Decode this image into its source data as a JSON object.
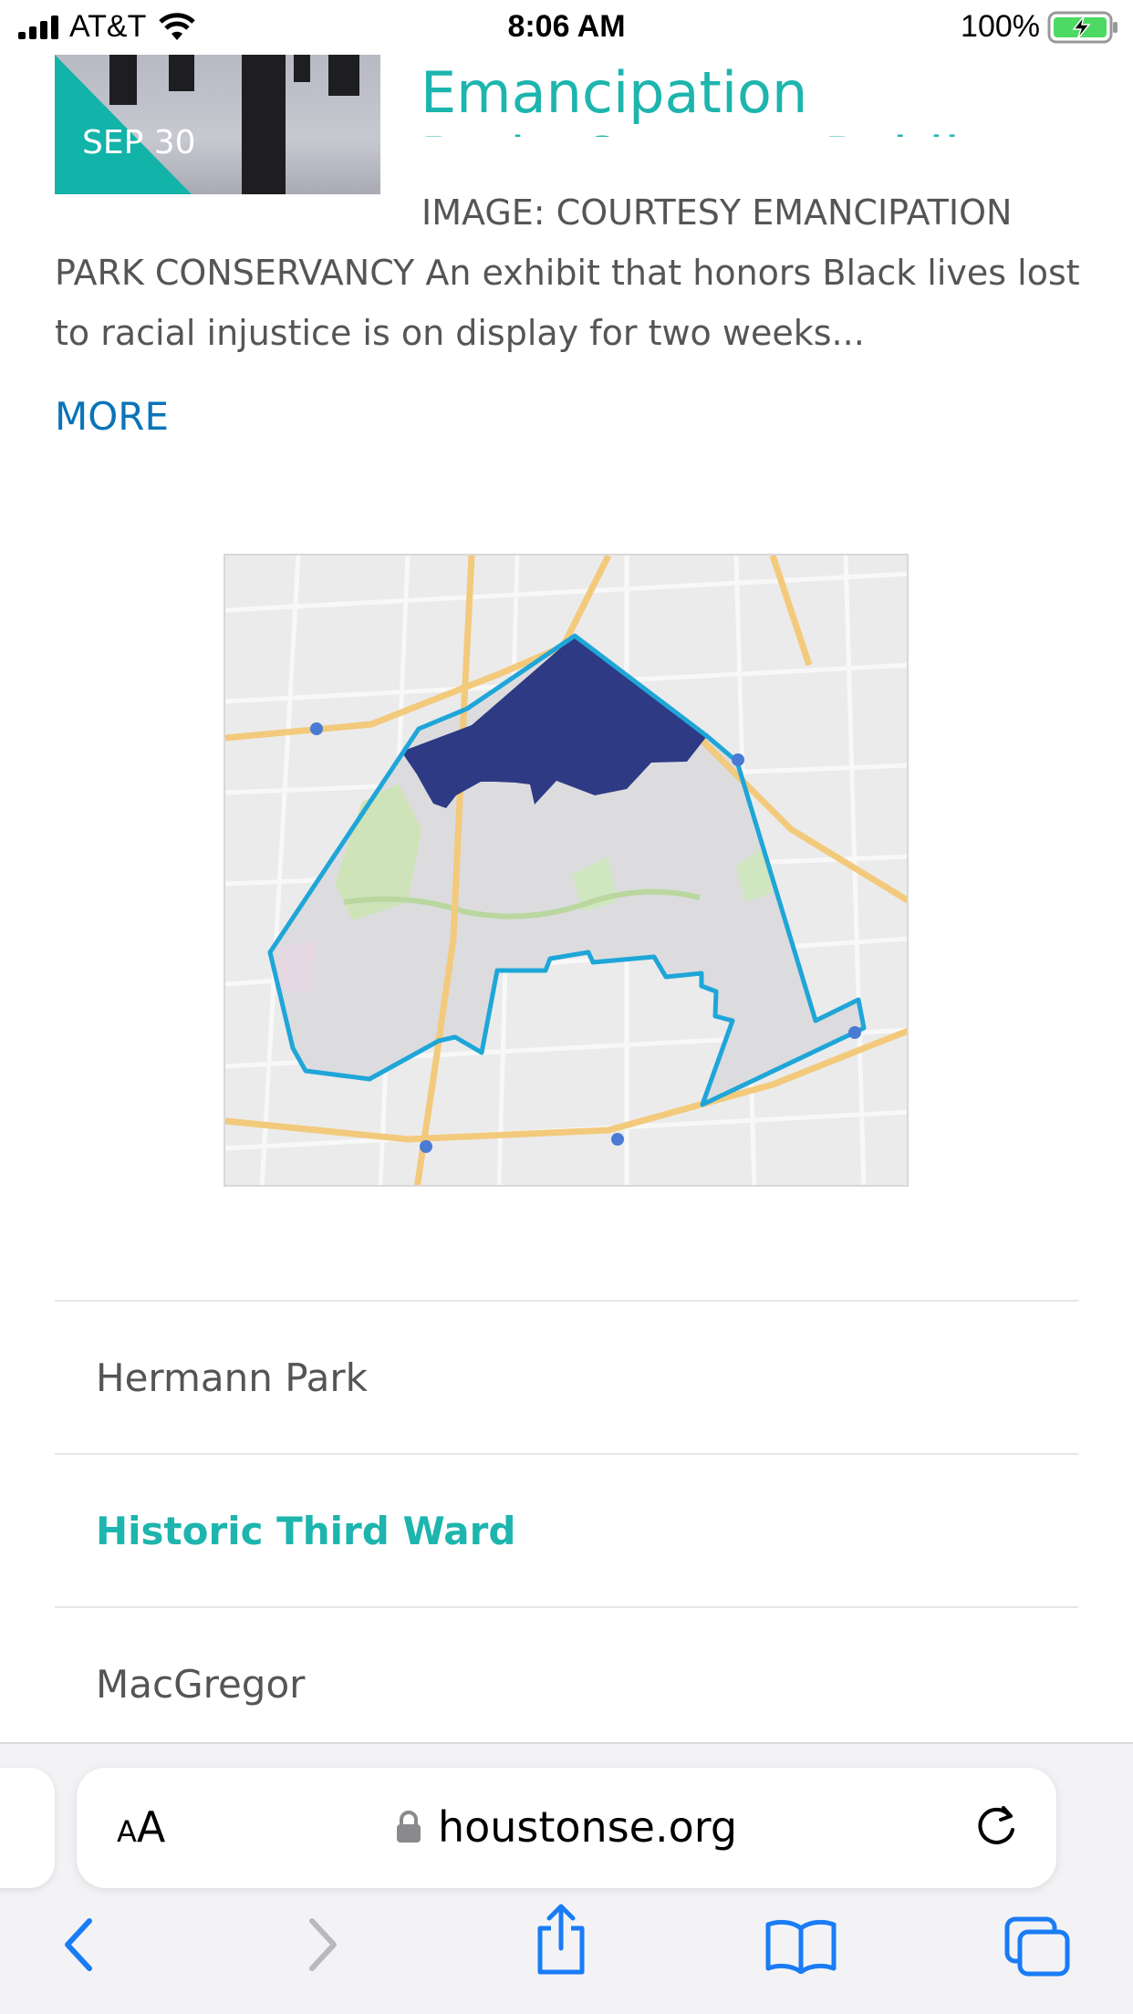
{
  "status_bar": {
    "carrier": "AT&T",
    "time": "8:06 AM",
    "battery": "100%"
  },
  "article": {
    "thumbnail_date": "SEP 30",
    "title_line1": "Arrives at Emancipation",
    "title_line2": "Park: Open to Public",
    "excerpt": "IMAGE: COURTESY EMANCIPATION PARK CONSERVANCY An exhibit that honors Black lives lost to racial injustice is on display for two weeks...",
    "more_label": "MORE"
  },
  "map": {
    "boundary_color": "#1fa6d8",
    "highlight_color": "#2e3a84"
  },
  "nav_list": {
    "items": [
      {
        "label": "Hermann Park",
        "active": false
      },
      {
        "label": "Historic Third Ward",
        "active": true
      },
      {
        "label": "MacGregor",
        "active": false
      }
    ]
  },
  "browser": {
    "aa_small": "A",
    "aa_big": "A",
    "url": "houstonse.org",
    "accent": "#1a7cf5"
  },
  "colors": {
    "title": "#1db5ad",
    "link": "#0a73b8",
    "text": "#555555"
  }
}
